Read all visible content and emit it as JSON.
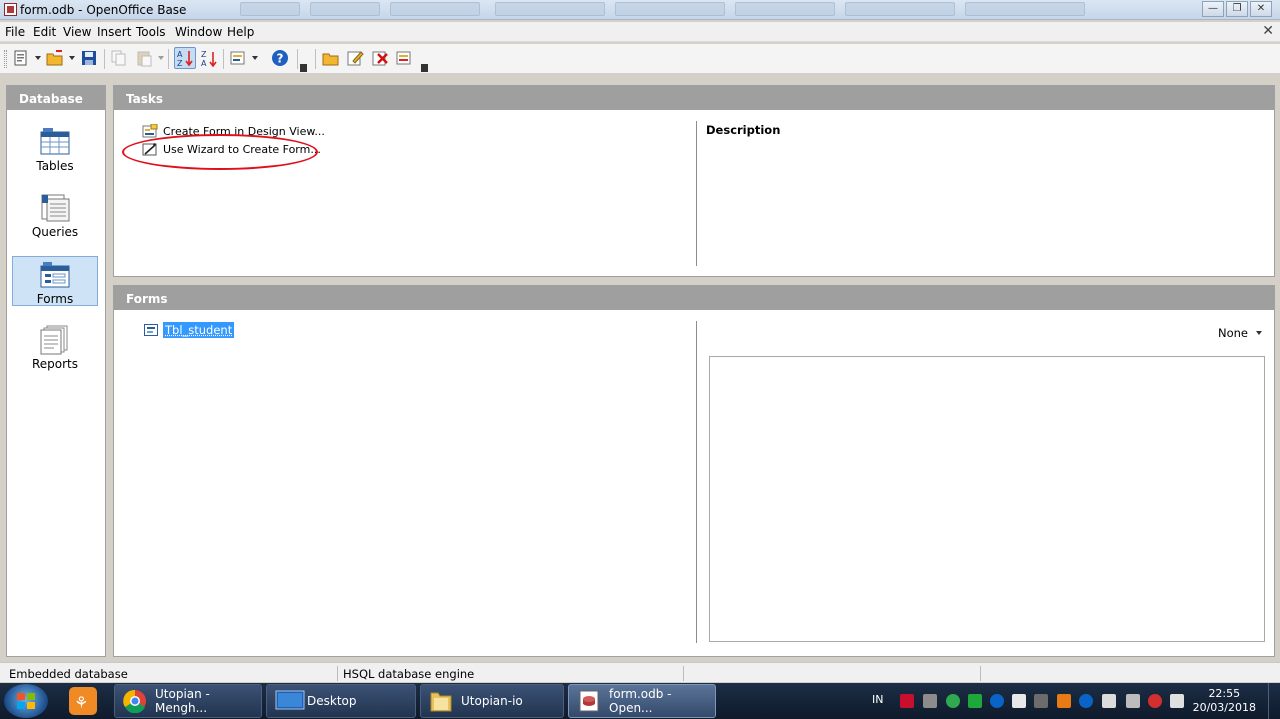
{
  "window": {
    "title": "form.odb - OpenOffice Base"
  },
  "menu": [
    "File",
    "Edit",
    "View",
    "Insert",
    "Tools",
    "Window",
    "Help"
  ],
  "toolbar": {
    "icons": [
      "new-icon",
      "open-icon",
      "save-icon",
      "copy-icon",
      "paste-icon",
      "sort-ascending-icon",
      "sort-descending-icon",
      "form-icon",
      "help-icon",
      "open-object-icon",
      "edit-object-icon",
      "delete-object-icon",
      "rename-object-icon"
    ]
  },
  "database_panel": {
    "header": "Database",
    "items": [
      {
        "label": "Tables",
        "icon": "tables-icon",
        "selected": false
      },
      {
        "label": "Queries",
        "icon": "queries-icon",
        "selected": false
      },
      {
        "label": "Forms",
        "icon": "forms-icon",
        "selected": true
      },
      {
        "label": "Reports",
        "icon": "reports-icon",
        "selected": false
      }
    ]
  },
  "tasks": {
    "header": "Tasks",
    "items": [
      {
        "label": "Create Form in Design View...",
        "icon": "design-view-icon"
      },
      {
        "label": "Use Wizard to Create Form...",
        "icon": "wizard-icon"
      }
    ],
    "description_label": "Description"
  },
  "forms": {
    "header": "Forms",
    "items": [
      {
        "label": "Tbl_student",
        "icon": "form-document-icon",
        "selected": true
      }
    ],
    "preview_mode": "None"
  },
  "statusbar": {
    "left": "Embedded database",
    "middle": "HSQL database engine"
  },
  "taskbar": {
    "tasks": [
      {
        "label": "Utopian - Mengh...",
        "icon": "chrome-icon"
      },
      {
        "label": "Desktop",
        "icon": "desktop-icon"
      },
      {
        "label": "Utopian-io",
        "icon": "folder-icon"
      },
      {
        "label": "form.odb - Open...",
        "icon": "openoffice-icon",
        "active": true
      }
    ],
    "language": "IN",
    "time": "22:55",
    "date": "20/03/2018"
  },
  "colors": {
    "panel_header": "#9f9f9f",
    "selection": "#3399ff",
    "annotation_circle": "#e0101a",
    "taskbar": "#1c2e45"
  }
}
